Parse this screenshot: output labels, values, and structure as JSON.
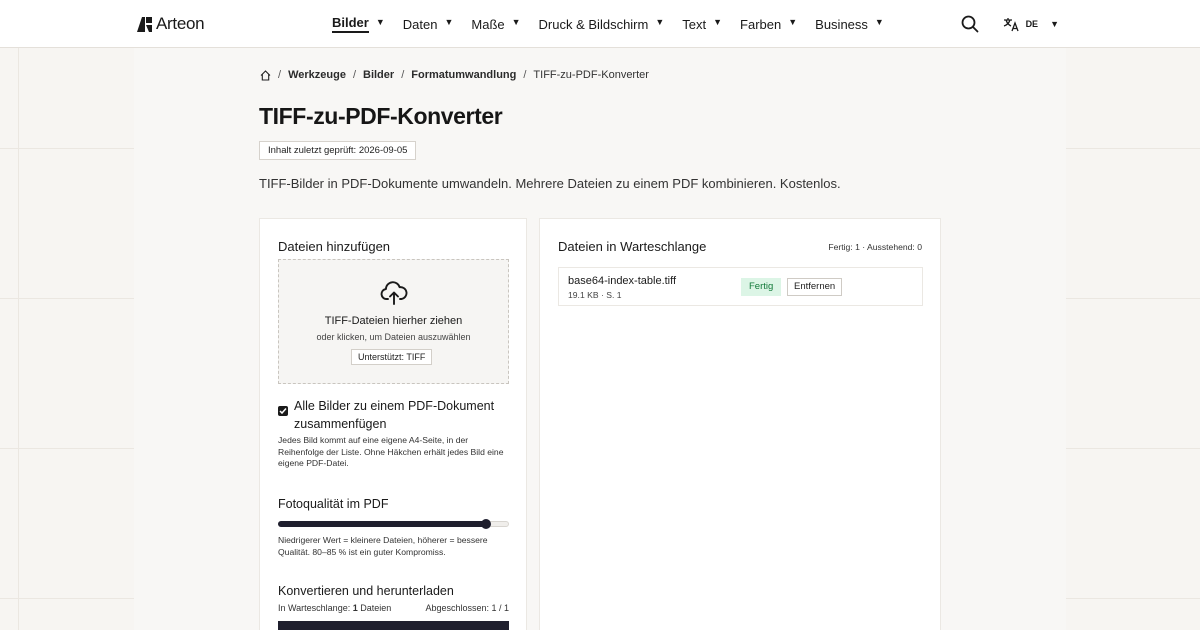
{
  "header": {
    "brand": "Arteon",
    "nav": [
      {
        "label": "Bilder",
        "active": true
      },
      {
        "label": "Daten",
        "active": false
      },
      {
        "label": "Maße",
        "active": false
      },
      {
        "label": "Druck & Bildschirm",
        "active": false
      },
      {
        "label": "Text",
        "active": false
      },
      {
        "label": "Farben",
        "active": false
      },
      {
        "label": "Business",
        "active": false
      }
    ],
    "search_icon": "search-icon",
    "language_icon": "translate-icon",
    "language": "DE"
  },
  "breadcrumb": {
    "home_icon": "home-icon",
    "items": [
      "Werkzeuge",
      "Bilder",
      "Formatumwandlung"
    ],
    "current": "TIFF-zu-PDF-Konverter"
  },
  "page": {
    "title": "TIFF-zu-PDF-Konverter",
    "review_badge": "Inhalt zuletzt geprüft: 2026-09-05",
    "intro": "TIFF-Bilder in PDF-Dokumente umwandeln. Mehrere Dateien zu einem PDF kombinieren. Kostenlos."
  },
  "add_files": {
    "title": "Dateien hinzufügen",
    "upload_icon": "cloud-upload-icon",
    "drop_main": "TIFF-Dateien hierher ziehen",
    "drop_sub": "oder klicken, um Dateien auszuwählen",
    "supported": "Unterstützt: TIFF",
    "merge_checked": true,
    "merge_label": "Alle Bilder zu einem PDF-Dokument zusammenfügen",
    "merge_help": "Jedes Bild kommt auf eine eigene A4-Seite, in der Reihenfolge der Liste. Ohne Häkchen erhält jedes Bild eine eigene PDF-Datei.",
    "quality_title": "Fotoqualität im PDF",
    "quality_level": 0.9,
    "quality_help": "Niedrigerer Wert = kleinere Dateien, höherer = bessere Qualität. 80–85 % ist ein guter Kompromiss.",
    "convert_title": "Konvertieren und herunterladen",
    "queue_label": "In Warteschlange:",
    "queue_count": "1",
    "queue_unit": "Dateien",
    "done_label": "Abgeschlossen: 1 / 1"
  },
  "queue": {
    "title": "Dateien in Warteschlange",
    "status": "Fertig: 1 · Ausstehend: 0",
    "files": [
      {
        "name": "base64-index-table.tiff",
        "meta": "19.1 KB · S. 1",
        "status": "Fertig",
        "remove_label": "Entfernen"
      }
    ]
  },
  "colors": {
    "accent": "#1f1f2e",
    "success_bg": "#dcf5e6",
    "success_text": "#137a3a"
  }
}
